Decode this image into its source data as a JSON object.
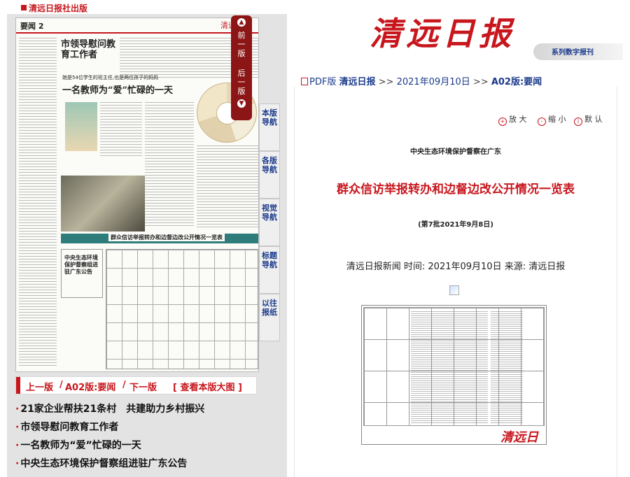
{
  "top": {
    "brand": "清远日报社出版"
  },
  "masthead": {
    "title": "清远日报",
    "series": "系列数字报刊"
  },
  "breadcrumb": {
    "pdf": "PDF版",
    "paper": "清远日报",
    "sep1": ">>",
    "date": "2021年09月10日",
    "sep2": ">>",
    "section": "A02版:要闻"
  },
  "page_thumb": {
    "label": "要闻 2",
    "logo": "清远日报",
    "headline1": "市领导慰问教育工作者",
    "headline2": "一名教师为“爱”忙碌的一天",
    "subhead2": "她是54位学生的班主任,也是两位孩子的妈妈",
    "band": "中央生态环境保护督察在广东",
    "band_title": "群众信访举报转办和边督边改公开情况一览表",
    "box": "中央生态环境保护督察组进驻广东公告"
  },
  "arrows": {
    "prev": "前一版",
    "next": "后一版"
  },
  "nav_tabs": [
    "本版导航",
    "各版导航",
    "视觉导航",
    "标题导航",
    "以往报纸"
  ],
  "page_nav": {
    "prev": "上一版",
    "current": "A02版:要闻",
    "next": "下一版",
    "view": "[ 查看本版大图 ]"
  },
  "articles": [
    "21家企业帮扶21条村　共建助力乡村振兴",
    "市领导慰问教育工作者",
    "一名教师为“爱”忙碌的一天",
    "中央生态环境保护督察组进驻广东公告"
  ],
  "zoom": {
    "in": "放 大",
    "out": "缩 小",
    "default": "默 认"
  },
  "article": {
    "kicker": "中央生态环境保护督察在广东",
    "title": "群众信访举报转办和边督边改公开情况一览表",
    "subtitle": "(第7批2021年9月8日)",
    "meta": "清远日报新闻 时间: 2021年09月10日 来源: 清远日报",
    "image_logo": "清远日报"
  }
}
